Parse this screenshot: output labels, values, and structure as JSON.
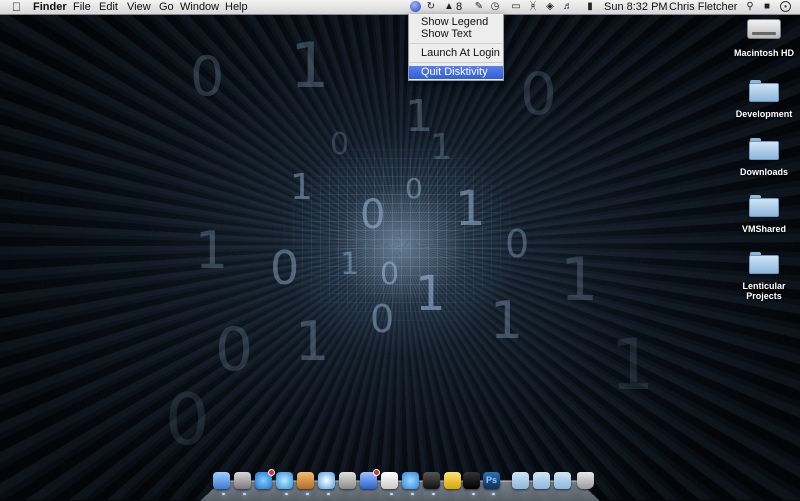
{
  "menubar": {
    "apple": "",
    "app_name": "Finder",
    "menus": [
      "File",
      "Edit",
      "View",
      "Go",
      "Window",
      "Help"
    ],
    "status_number": "8",
    "clock": "Sun 8:32 PM",
    "user": "Chris Fletcher"
  },
  "status_menu": {
    "items": [
      "Show Legend",
      "Show Text",
      "Launch At Login",
      "Quit Disktivity"
    ],
    "highlighted": "Quit Disktivity"
  },
  "desktop_icons": [
    {
      "label": "Macintosh HD",
      "icon": "hard-drive-icon"
    },
    {
      "label": "Development",
      "icon": "folder-icon"
    },
    {
      "label": "Downloads",
      "icon": "folder-icon"
    },
    {
      "label": "VMShared",
      "icon": "folder-icon"
    },
    {
      "label": "Lenticular\nProjects",
      "icon": "folder-icon"
    }
  ],
  "wallpaper_digits": [
    "0",
    "1",
    "0",
    "1",
    "1",
    "0",
    "1",
    "0",
    "1",
    "0",
    "1",
    "0",
    "1",
    "0",
    "1",
    "0",
    "1",
    "0",
    "1",
    "0",
    "1",
    "1",
    "0"
  ],
  "dock": {
    "apps": [
      "finder-icon",
      "launchpad-icon",
      "app-store-icon",
      "itunes-icon",
      "photo-icon",
      "safari-icon",
      "mail-icon",
      "pencil-icon",
      "textedit-icon",
      "messages-icon",
      "camera-icon",
      "gauge-icon",
      "terminal-icon",
      "photoshop-icon",
      "folder-icon",
      "folder-icon",
      "folder-icon",
      "trash-icon"
    ],
    "ps_label": "Ps"
  },
  "colors": {
    "menu_highlight": "#2f5ed8",
    "badge": "#e12b2b"
  }
}
